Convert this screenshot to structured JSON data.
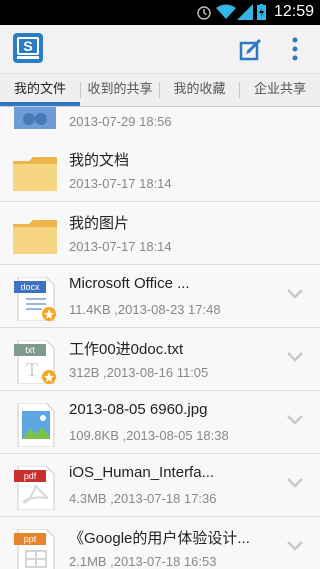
{
  "status": {
    "time": "12:59"
  },
  "tabs": [
    {
      "label": "我的文件"
    },
    {
      "label": "收到的共享"
    },
    {
      "label": "我的收藏"
    },
    {
      "label": "企业共享"
    }
  ],
  "files": [
    {
      "name": "",
      "meta": "2013-07-29 18:56",
      "icon": "shared-folder-icon"
    },
    {
      "name": "我的文档",
      "meta": "2013-07-17 18:14",
      "icon": "folder-icon"
    },
    {
      "name": "我的图片",
      "meta": "2013-07-17 18:14",
      "icon": "folder-icon"
    },
    {
      "name": "Microsoft Office ...",
      "meta": "11.4KB ,2013-08-23 17:48",
      "icon": "docx-icon",
      "type_label": "docx"
    },
    {
      "name": "工作00进0doc.txt",
      "meta": "312B ,2013-08-16 11:05",
      "icon": "txt-icon",
      "type_label": "txt"
    },
    {
      "name": "2013-08-05 6960.jpg",
      "meta": "109.8KB ,2013-08-05 18:38",
      "icon": "image-icon"
    },
    {
      "name": "iOS_Human_Interfa...",
      "meta": "4.3MB ,2013-07-18 17:36",
      "icon": "pdf-icon",
      "type_label": "pdf"
    },
    {
      "name": "《Google的用户体验设计...",
      "meta": "2.1MB ,2013-07-18 16:53",
      "icon": "ppt-icon",
      "type_label": "ppt"
    }
  ],
  "colors": {
    "accent": "#2f79c4",
    "folder": "#f5c96a"
  }
}
